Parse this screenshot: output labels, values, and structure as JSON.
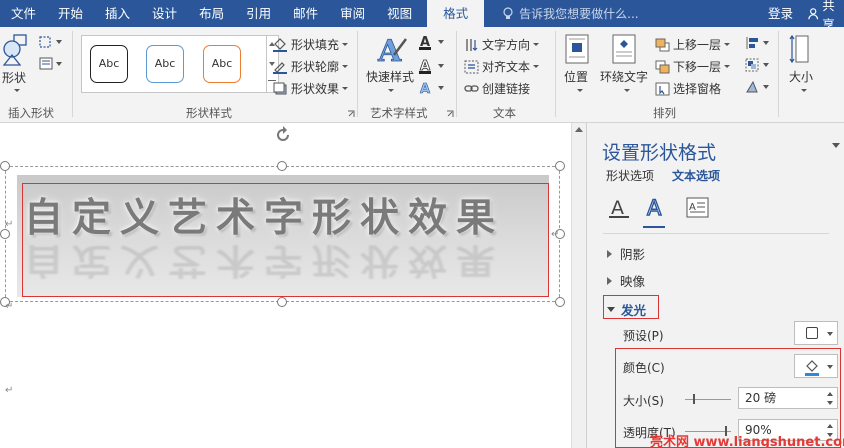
{
  "tabs": [
    {
      "label": "文件"
    },
    {
      "label": "开始"
    },
    {
      "label": "插入"
    },
    {
      "label": "设计"
    },
    {
      "label": "布局"
    },
    {
      "label": "引用"
    },
    {
      "label": "邮件"
    },
    {
      "label": "审阅"
    },
    {
      "label": "视图"
    },
    {
      "label": "格式",
      "active": true
    }
  ],
  "tell_me": {
    "placeholder": "告诉我您想要做什么..."
  },
  "account": {
    "login": "登录",
    "share": "共享"
  },
  "ribbon": {
    "insert_shapes": {
      "shape_label": "形状",
      "group_label": "插入形状"
    },
    "shape_styles": {
      "gallery": [
        "Abc",
        "Abc",
        "Abc"
      ],
      "fill": "形状填充",
      "outline": "形状轮廓",
      "effects": "形状效果",
      "group_label": "形状样式"
    },
    "wordart": {
      "quick_styles": "快速样式",
      "group_label": "艺术字样式"
    },
    "text": {
      "direction": "文字方向",
      "align": "对齐文本",
      "link": "创建链接",
      "group_label": "文本"
    },
    "arrange": {
      "position": "位置",
      "wrap": "环绕文字",
      "forward": "上移一层",
      "backward": "下移一层",
      "selection_pane": "选择窗格",
      "group_label": "排列"
    },
    "size": {
      "label": "大小"
    }
  },
  "document": {
    "wordart_text": "自定义艺术字形状效果"
  },
  "pane": {
    "title": "设置形状格式",
    "tabs": [
      "形状选项",
      "文本选项"
    ],
    "sections": {
      "shadow": "阴影",
      "reflection": "映像",
      "glow": "发光"
    },
    "preset_label": "预设(P)",
    "color_label": "颜色(C)",
    "size_label": "大小(S)",
    "size_value": "20 磅",
    "transparency_label": "透明度(T)",
    "transparency_value": "90%",
    "size_fraction": 0.2,
    "transparency_fraction": 0.9
  },
  "colors": {
    "accent": "#2b579a",
    "highlight": "#d33333"
  },
  "watermark": "亮术网 www.liangshunet.com"
}
